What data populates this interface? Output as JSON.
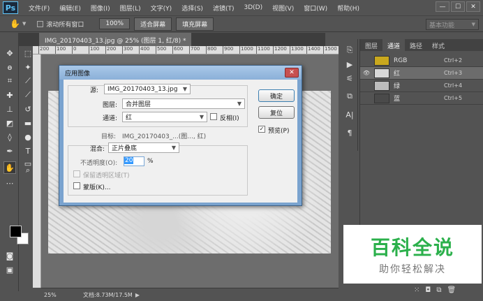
{
  "app": {
    "logo": "Ps",
    "menu": [
      "文件(F)",
      "编辑(E)",
      "图像(I)",
      "图层(L)",
      "文字(Y)",
      "选择(S)",
      "滤镜(T)",
      "3D(D)",
      "视图(V)",
      "窗口(W)",
      "帮助(H)"
    ],
    "window_controls": [
      "—",
      "☐",
      "✕"
    ]
  },
  "options_bar": {
    "scroll_all_label": "滚动所有窗口",
    "zoom_100": "100%",
    "fit_screen": "适合屏幕",
    "fill_screen": "填充屏幕",
    "workspace": "基本功能"
  },
  "document": {
    "tab_title": "IMG_20170403_13.jpg @ 25% (图层 1, 红/8) *",
    "ruler_ticks": [
      "200",
      "100",
      "0",
      "100",
      "200",
      "300",
      "400",
      "500",
      "600",
      "700",
      "800",
      "900",
      "1000",
      "1100",
      "1200",
      "1300",
      "1400",
      "1500"
    ]
  },
  "status": {
    "zoom": "25%",
    "doc_info": "文档:8.73M/17.5M"
  },
  "channels_panel": {
    "tabs": [
      "图层",
      "通道",
      "路径",
      "样式"
    ],
    "active_tab": 1,
    "channels": [
      {
        "name": "RGB",
        "shortcut": "Ctrl+2",
        "color": "#c9a81e"
      },
      {
        "name": "红",
        "shortcut": "Ctrl+3",
        "color": "#d8d8d8"
      },
      {
        "name": "绿",
        "shortcut": "Ctrl+4",
        "color": "#bcbcbc"
      },
      {
        "name": "蓝",
        "shortcut": "Ctrl+5",
        "color": "#4a4a4a"
      }
    ],
    "selected_index": 1
  },
  "dialog": {
    "title": "应用图像",
    "source_label": "源:",
    "source_value": "IMG_20170403_13.jpg",
    "layer_label": "图层:",
    "layer_value": "合并图层",
    "channel_label": "通道:",
    "channel_value": "红",
    "invert_label": "反相(I)",
    "target_label": "目标:",
    "target_value": "IMG_20170403_...(图..., 红)",
    "blend_label": "混合:",
    "blend_value": "正片叠底",
    "opacity_label": "不透明度(O):",
    "opacity_value": "20",
    "opacity_unit": "%",
    "preserve_label": "保留透明区域(T)",
    "mask_label": "蒙版(K)...",
    "ok": "确定",
    "reset": "复位",
    "preview_label": "预览(P)",
    "close": "✕"
  },
  "watermark": {
    "title": "百科全说",
    "subtitle": "助你轻松解决"
  }
}
